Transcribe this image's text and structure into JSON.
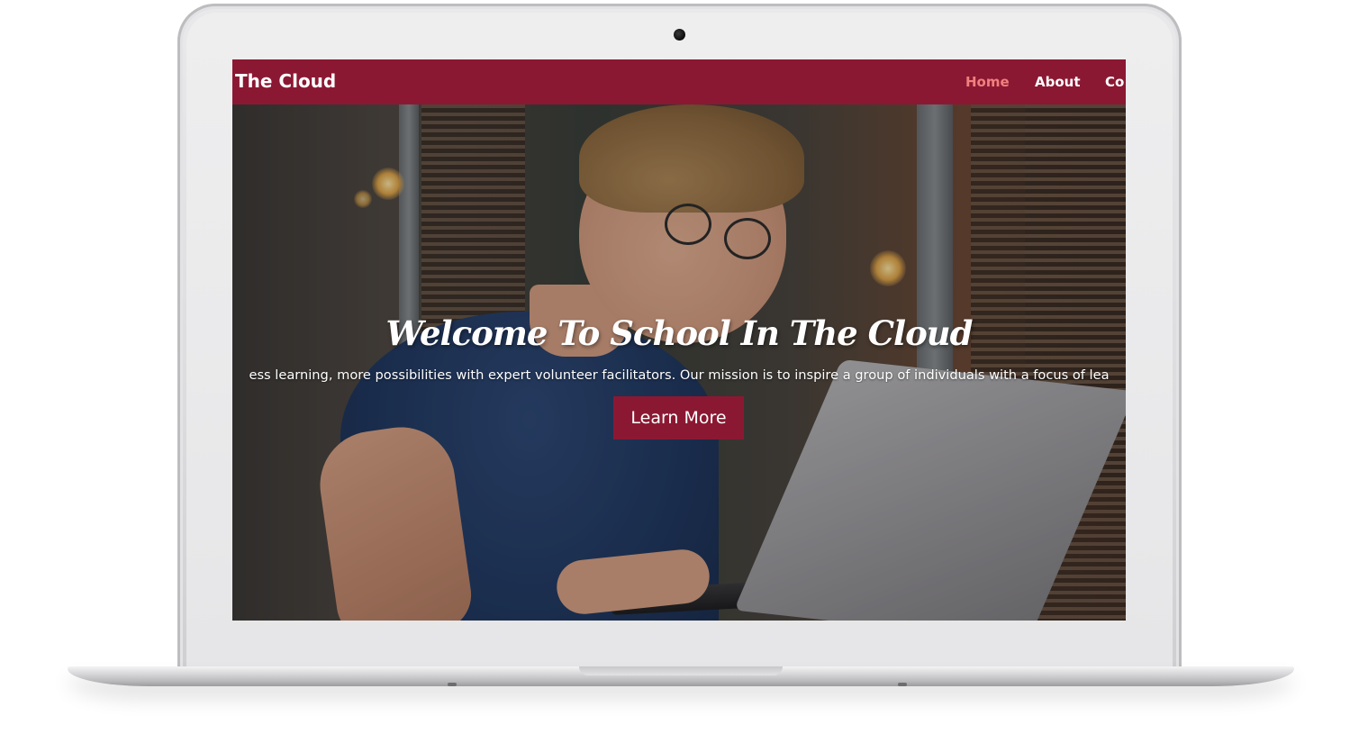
{
  "navbar": {
    "brand": "The Cloud",
    "links": [
      {
        "label": "Home",
        "active": true
      },
      {
        "label": "About",
        "active": false
      },
      {
        "label": "Co",
        "active": false
      }
    ]
  },
  "hero": {
    "title": "Welcome To School In The Cloud",
    "tagline": "ess learning, more possibilities with expert volunteer facilitators. Our mission is to inspire a group of individuals with a focus of lea",
    "button_label": "Learn More"
  },
  "colors": {
    "brand_primary": "#8b1832",
    "nav_active": "#f0807f",
    "text_on_dark": "#ffffff"
  }
}
